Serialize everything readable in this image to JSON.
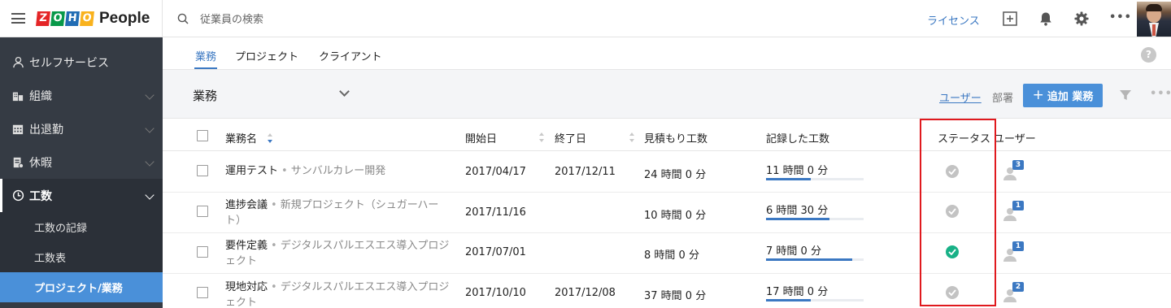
{
  "header": {
    "logo_letters": [
      "Z",
      "O",
      "H",
      "O"
    ],
    "logo_colors": [
      "#e42527",
      "#089949",
      "#226db4",
      "#f9b21d"
    ],
    "logo_text": "People",
    "search_placeholder": "従業員の検索",
    "license_label": "ライセンス",
    "more_label": "•••"
  },
  "sidebar": {
    "items": [
      {
        "label": "セルフサービス",
        "icon": "person-icon"
      },
      {
        "label": "組織",
        "icon": "organization-icon"
      },
      {
        "label": "出退勤",
        "icon": "calendar-icon"
      },
      {
        "label": "休暇",
        "icon": "leave-icon"
      },
      {
        "label": "工数",
        "icon": "clock-icon"
      }
    ],
    "sub_items": [
      {
        "label": "工数の記録"
      },
      {
        "label": "工数表"
      },
      {
        "label": "プロジェクト/業務"
      }
    ]
  },
  "tabs": [
    "業務",
    "プロジェクト",
    "クライアント"
  ],
  "help_label": "?",
  "toolbar": {
    "view_title": "業務",
    "user_link": "ユーザー",
    "dept_link": "部署",
    "add_plus": "+",
    "add_label": "追加 業務",
    "more_label": "•••"
  },
  "table": {
    "columns": {
      "task": "業務名",
      "start": "開始日",
      "end": "終了日",
      "estimate": "見積もり工数",
      "logged": "記録した工数",
      "status": "ステータス",
      "users": "ユーザー"
    },
    "rows": [
      {
        "task": "運用テスト",
        "project": "サンバルカレー開発",
        "start": "2017/04/17",
        "end": "2017/12/11",
        "estimate": "24 時間 0 分",
        "logged": "11 時間 0 分",
        "progress": 0.46,
        "status": "pending",
        "users": "3"
      },
      {
        "task": "進捗会議",
        "project": "新規プロジェクト（シュガーハート）",
        "start": "2017/11/16",
        "end": "",
        "estimate": "10 時間 0 分",
        "logged": "6 時間 30 分",
        "progress": 0.65,
        "status": "pending",
        "users": "1"
      },
      {
        "task": "要件定義",
        "project": "デジタルスパルエスエス導入プロジェクト",
        "start": "2017/07/01",
        "end": "",
        "estimate": "8 時間 0 分",
        "logged": "7 時間 0 分",
        "progress": 0.88,
        "status": "done",
        "users": "1"
      },
      {
        "task": "現地対応",
        "project": "デジタルスパルエスエス導入プロジェクト",
        "start": "2017/10/10",
        "end": "2017/12/08",
        "estimate": "37 時間 0 分",
        "logged": "17 時間 0 分",
        "progress": 0.46,
        "status": "pending",
        "users": "2"
      }
    ]
  },
  "colors": {
    "accent": "#3b78c2",
    "sidebar": "#353b44",
    "selected": "#4a90d9",
    "done": "#19b187",
    "highlight": "#e0191e"
  }
}
